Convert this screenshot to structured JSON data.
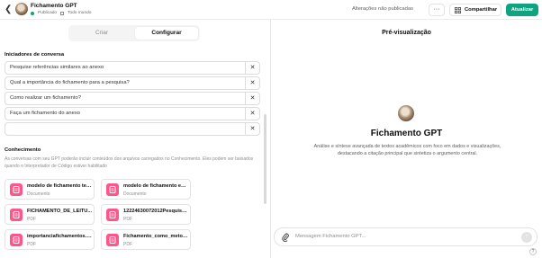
{
  "header": {
    "back_glyph": "❮",
    "gpt_name": "Fichamento GPT",
    "status": "Publicado",
    "visibility": "Todo mundo",
    "unsaved": "Alterações não publicadas",
    "more_glyph": "···",
    "share_label": "Compartilhar",
    "update_label": "Atualizar",
    "colors": {
      "accent": "#10a37f"
    }
  },
  "tabs": [
    {
      "label": "Criar",
      "active": false
    },
    {
      "label": "Configurar",
      "active": true
    }
  ],
  "starters": {
    "title": "Iniciadores de conversa",
    "items": [
      "Pesquise referências similares ao anexo",
      "Qual a importância do fichamento para a pesquisa?",
      "Como realizar um fichamento?",
      "Faça um fichamento do anexo",
      ""
    ],
    "remove_glyph": "✕"
  },
  "knowledge": {
    "title": "Conhecimento",
    "description": "As conversas com seu GPT poderão incluir conteúdos dos arquivos carregados no Conhecimento. Eles podem ser baixados quando o Interpretador de Código estiver habilitado",
    "files": [
      {
        "name": "modelo de fichamento teó...",
        "type": "Documento"
      },
      {
        "name": "modelo de fichamento em...",
        "type": "Documento"
      },
      {
        "name": "FICHAMENTO_DE_LEITU...",
        "type": "PDF"
      },
      {
        "name": "12224630072012Pesquisa...",
        "type": "PDF"
      },
      {
        "name": "importanciafichamentos.p...",
        "type": "PDF"
      },
      {
        "name": "Fichamento_como_metod...",
        "type": "PDF"
      }
    ],
    "file_icon_color": "#ff5588"
  },
  "preview": {
    "title": "Pré-visualização",
    "gpt_name": "Fichamento GPT",
    "description": "Análise e síntese avançada de textos acadêmicos com foco em dados e visualizações, destacando a citação principal que sintetiza o argumento central.",
    "composer_placeholder": "Mensagem Fichamento GPT...",
    "send_glyph": "↑",
    "help_glyph": "?"
  }
}
